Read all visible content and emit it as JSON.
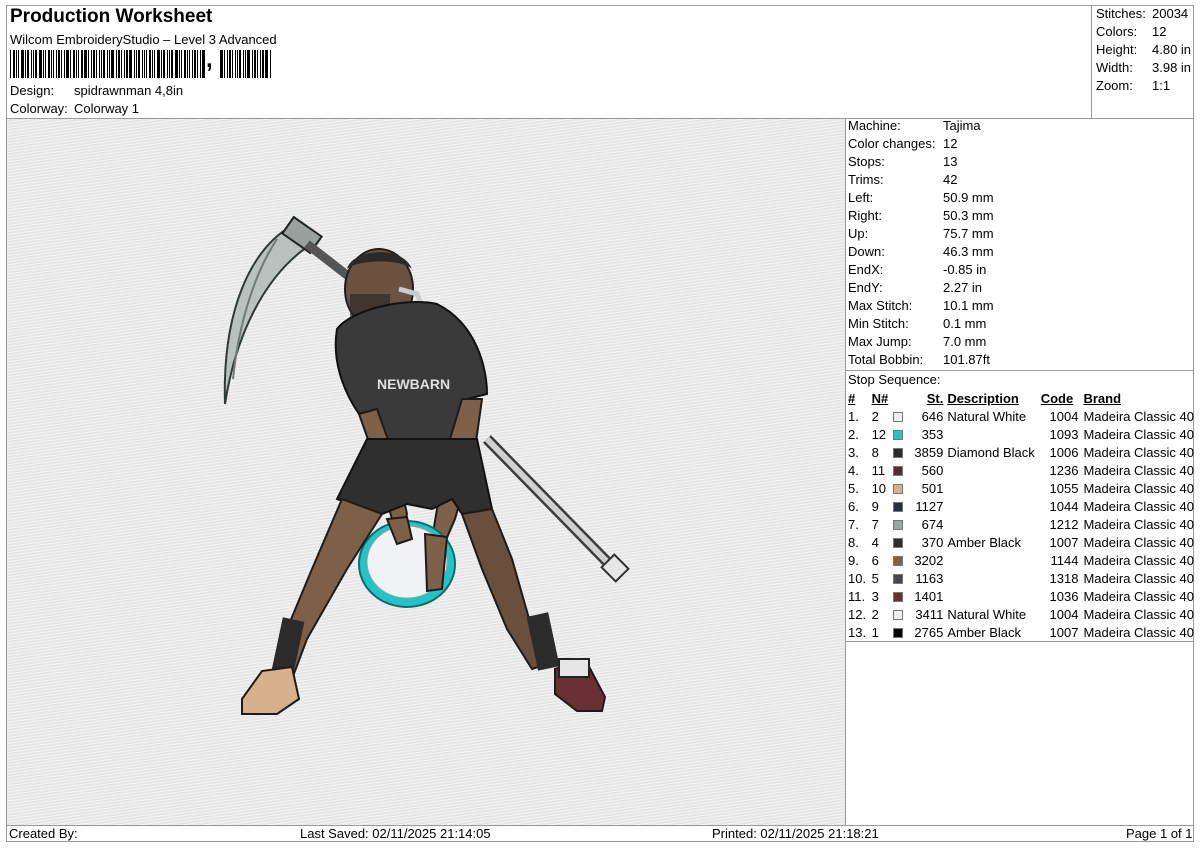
{
  "header": {
    "title": "Production Worksheet",
    "subtitle": "Wilcom EmbroideryStudio – Level 3 Advanced",
    "barcode_glyph": ","
  },
  "design": {
    "label": "Design:",
    "value": "spidrawnman 4,8in"
  },
  "colorway": {
    "label": "Colorway:",
    "value": "Colorway 1"
  },
  "stats": [
    {
      "label": "Stitches:",
      "value": "20034"
    },
    {
      "label": "Colors:",
      "value": "12"
    },
    {
      "label": "Height:",
      "value": "4.80 in"
    },
    {
      "label": "Width:",
      "value": "3.98 in"
    },
    {
      "label": "Zoom:",
      "value": "1:1"
    }
  ],
  "machine_info": [
    {
      "label": "Machine:",
      "value": "Tajima"
    },
    {
      "label": "Color changes:",
      "value": "12"
    },
    {
      "label": "Stops:",
      "value": "13"
    },
    {
      "label": "Trims:",
      "value": "42"
    },
    {
      "label": "Left:",
      "value": "50.9 mm"
    },
    {
      "label": "Right:",
      "value": "50.3 mm"
    },
    {
      "label": "Up:",
      "value": "75.7 mm"
    },
    {
      "label": "Down:",
      "value": "46.3 mm"
    },
    {
      "label": "EndX:",
      "value": "-0.85 in"
    },
    {
      "label": "EndY:",
      "value": "2.27 in"
    },
    {
      "label": "Max Stitch:",
      "value": "10.1 mm"
    },
    {
      "label": "Min Stitch:",
      "value": "0.1 mm"
    },
    {
      "label": "Max Jump:",
      "value": "7.0 mm"
    },
    {
      "label": "Total Bobbin:",
      "value": "101.87ft"
    }
  ],
  "stop_sequence": {
    "title": "Stop Sequence:",
    "columns": [
      "#",
      "N#",
      "St.",
      "Description",
      "Code",
      "Brand"
    ],
    "rows": [
      {
        "idx": "1.",
        "n": "2",
        "color": "#eeeef3",
        "st": "646",
        "desc": "Natural White",
        "code": "1004",
        "brand": "Madeira Classic 40"
      },
      {
        "idx": "2.",
        "n": "12",
        "color": "#22c4c8",
        "st": "353",
        "desc": "",
        "code": "1093",
        "brand": "Madeira Classic 40"
      },
      {
        "idx": "3.",
        "n": "8",
        "color": "#2b2b2b",
        "st": "3859",
        "desc": "Diamond Black",
        "code": "1006",
        "brand": "Madeira Classic 40"
      },
      {
        "idx": "4.",
        "n": "11",
        "color": "#5a2a32",
        "st": "560",
        "desc": "",
        "code": "1236",
        "brand": "Madeira Classic 40"
      },
      {
        "idx": "5.",
        "n": "10",
        "color": "#d7b08c",
        "st": "501",
        "desc": "",
        "code": "1055",
        "brand": "Madeira Classic 40"
      },
      {
        "idx": "6.",
        "n": "9",
        "color": "#2a2e3a",
        "st": "1127",
        "desc": "",
        "code": "1044",
        "brand": "Madeira Classic 40"
      },
      {
        "idx": "7.",
        "n": "7",
        "color": "#9fa5a4",
        "st": "674",
        "desc": "",
        "code": "1212",
        "brand": "Madeira Classic 40"
      },
      {
        "idx": "8.",
        "n": "4",
        "color": "#2d2d2d",
        "st": "370",
        "desc": "Amber Black",
        "code": "1007",
        "brand": "Madeira Classic 40"
      },
      {
        "idx": "9.",
        "n": "6",
        "color": "#7e5f47",
        "st": "3202",
        "desc": "",
        "code": "1144",
        "brand": "Madeira Classic 40"
      },
      {
        "idx": "10.",
        "n": "5",
        "color": "#4a4650",
        "st": "1163",
        "desc": "",
        "code": "1318",
        "brand": "Madeira Classic 40"
      },
      {
        "idx": "11.",
        "n": "3",
        "color": "#6a2f35",
        "st": "1401",
        "desc": "",
        "code": "1036",
        "brand": "Madeira Classic 40"
      },
      {
        "idx": "12.",
        "n": "2",
        "color": "#eeeef3",
        "st": "3411",
        "desc": "Natural White",
        "code": "1004",
        "brand": "Madeira Classic 40"
      },
      {
        "idx": "13.",
        "n": "1",
        "color": "#050505",
        "st": "2765",
        "desc": "Amber Black",
        "code": "1007",
        "brand": "Madeira Classic 40"
      }
    ]
  },
  "footer": {
    "created_by": "Created By:",
    "last_saved": "Last Saved: 02/11/2025 21:14:05",
    "printed": "Printed: 02/11/2025 21:18:21",
    "page": "Page 1 of 1"
  }
}
